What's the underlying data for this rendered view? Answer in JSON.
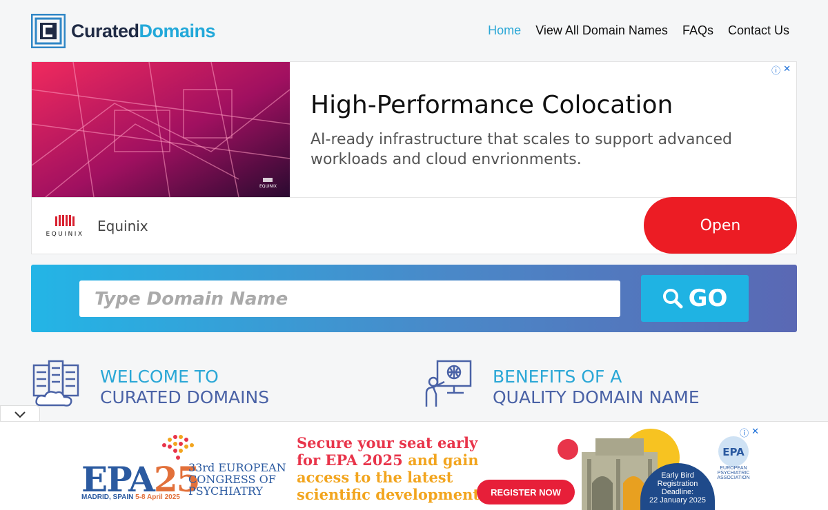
{
  "header": {
    "logo": {
      "part1": "Curated",
      "part2": "Domains"
    },
    "nav": [
      {
        "label": "Home",
        "active": true
      },
      {
        "label": "View All Domain Names",
        "active": false
      },
      {
        "label": "FAQs",
        "active": false
      },
      {
        "label": "Contact Us",
        "active": false
      }
    ]
  },
  "ad_top": {
    "title": "High-Performance Colocation",
    "description": "AI-ready infrastructure that scales to support advanced workloads and cloud envrionments.",
    "brand": "Equinix",
    "brand_logo_text": "EQUINIX",
    "image_logo_text": "EQUINIX",
    "cta": "Open",
    "choices_icons": [
      "info-icon",
      "close-icon"
    ]
  },
  "search": {
    "placeholder": "Type Domain Name",
    "button_label": "GO"
  },
  "features": [
    {
      "line1": "Welcome to",
      "line2": "Curated Domains"
    },
    {
      "line1": "Benefits of a",
      "line2": "Quality Domain Name"
    }
  ],
  "ad_bottom": {
    "epa": "EPA",
    "year": "25",
    "location": "MADRID, SPAIN",
    "dates": "5-8 April 2025",
    "congress_line1": "33rd EUROPEAN",
    "congress_line2": "CONGRESS OF",
    "congress_line3": "PSYCHIATRY",
    "headline_a": "Secure your seat early",
    "headline_b": "for EPA 2025",
    "headline_c": "and gain",
    "headline_d": "access to the latest",
    "headline_e": "scientific developments",
    "cta": "REGISTER NOW",
    "early_bird_1": "Early Bird",
    "early_bird_2": "Registration",
    "early_bird_3": "Deadline:",
    "early_bird_4": "22 January 2025",
    "assoc_badge": "EPA",
    "assoc_line1": "EUROPEAN",
    "assoc_line2": "PSYCHIATRIC",
    "assoc_line3": "ASSOCIATION"
  },
  "colors": {
    "brand_blue": "#22a8d9",
    "brand_dark": "#1f2a44",
    "cta_red": "#ec1c24"
  }
}
